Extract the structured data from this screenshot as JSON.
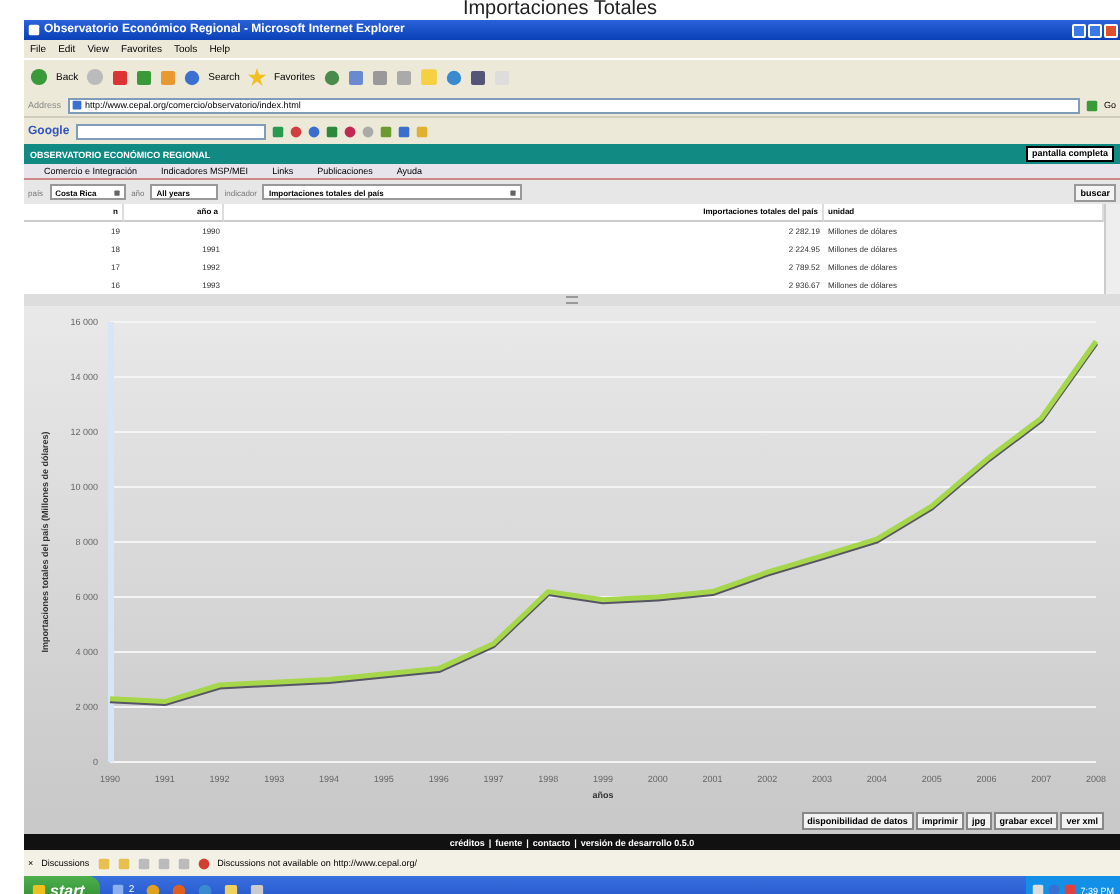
{
  "caption": "Importaciones Totales",
  "window": {
    "title": "Observatorio Económico Regional - Microsoft Internet Explorer"
  },
  "menu_bar": [
    "File",
    "Edit",
    "View",
    "Favorites",
    "Tools",
    "Help"
  ],
  "toolbar": {
    "back": "Back",
    "search": "Search",
    "favorites": "Favorites"
  },
  "address_bar": {
    "label": "Address",
    "value": "http://www.cepal.org/comercio/observatorio/index.html",
    "go": "Go"
  },
  "google_bar": {
    "logo": "Google"
  },
  "site": {
    "title": "OBSERVATORIO ECONÓMICO REGIONAL",
    "fullscreen_button": "pantalla completa",
    "nav": [
      "Comercio e Integración",
      "Indicadores MSP/MEI",
      "Links",
      "Publicaciones",
      "Ayuda"
    ],
    "filters": {
      "country_label": "país",
      "country": "Costa Rica",
      "year_label": "año",
      "year": "All years",
      "indicator_label": "indicador",
      "indicator": "Importaciones totales del país",
      "search_button": "buscar"
    },
    "table": {
      "columns": [
        "n",
        "año a",
        "Importaciones totales del país",
        "unidad"
      ],
      "rows": [
        [
          "19",
          "1990",
          "2 282.19",
          "Millones de dólares"
        ],
        [
          "18",
          "1991",
          "2 224.95",
          "Millones de dólares"
        ],
        [
          "17",
          "1992",
          "2 789.52",
          "Millones de dólares"
        ],
        [
          "16",
          "1993",
          "2 936.67",
          "Millones de dólares"
        ]
      ]
    },
    "chart_data": {
      "type": "line",
      "xlabel": "años",
      "ylabel": "Importaciones totales del país (Millones de dólares)",
      "categories": [
        "1990",
        "1991",
        "1992",
        "1993",
        "1994",
        "1995",
        "1996",
        "1997",
        "1998",
        "1999",
        "2000",
        "2001",
        "2002",
        "2003",
        "2004",
        "2005",
        "2006",
        "2007",
        "2008"
      ],
      "series": [
        {
          "color": "#a6d64a",
          "values": [
            2300,
            2200,
            2800,
            2900,
            3000,
            3200,
            3400,
            4300,
            6200,
            5900,
            6000,
            6200,
            6900,
            7500,
            8100,
            9300,
            11000,
            12500,
            15300
          ]
        }
      ],
      "grid": true,
      "ylim": [
        0,
        16000
      ],
      "yticks": [
        {
          "value": 0,
          "label": "0"
        },
        {
          "value": 2000,
          "label": "2 000"
        },
        {
          "value": 4000,
          "label": "4 000"
        },
        {
          "value": 6000,
          "label": "6 000"
        },
        {
          "value": 8000,
          "label": "8 000"
        },
        {
          "value": 10000,
          "label": "10 000"
        },
        {
          "value": 12000,
          "label": "12 000"
        },
        {
          "value": 14000,
          "label": "14 000"
        },
        {
          "value": 16000,
          "label": "16 000"
        }
      ]
    },
    "buttons": [
      "disponibilidad de datos",
      "imprimir",
      "jpg",
      "grabar excel",
      "ver xml"
    ],
    "footer": {
      "links": [
        "créditos",
        "fuente",
        "contacto",
        "versión de desarrollo 0.5.0"
      ],
      "separator": "|"
    }
  },
  "discussions_bar": {
    "close": "×",
    "label": "Discussions",
    "message": "Discussions not available on http://www.cepal.org/"
  },
  "taskbar": {
    "start": "start",
    "group_count": "2",
    "time": "7:39 PM"
  }
}
